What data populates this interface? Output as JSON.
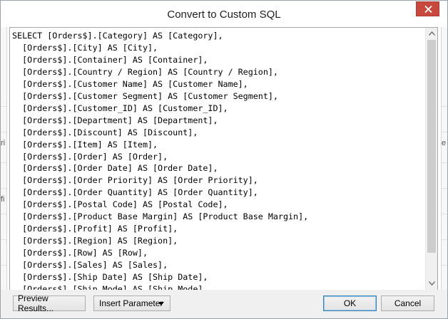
{
  "window": {
    "title": "Convert to Custom SQL"
  },
  "editor": {
    "lines": [
      "SELECT [Orders$].[Category] AS [Category],",
      "  [Orders$].[City] AS [City],",
      "  [Orders$].[Container] AS [Container],",
      "  [Orders$].[Country / Region] AS [Country / Region],",
      "  [Orders$].[Customer Name] AS [Customer Name],",
      "  [Orders$].[Customer Segment] AS [Customer Segment],",
      "  [Orders$].[Customer_ID] AS [Customer_ID],",
      "  [Orders$].[Department] AS [Department],",
      "  [Orders$].[Discount] AS [Discount],",
      "  [Orders$].[Item] AS [Item],",
      "  [Orders$].[Order] AS [Order],",
      "  [Orders$].[Order Date] AS [Order Date],",
      "  [Orders$].[Order Priority] AS [Order Priority],",
      "  [Orders$].[Order Quantity] AS [Order Quantity],",
      "  [Orders$].[Postal Code] AS [Postal Code],",
      "  [Orders$].[Product Base Margin] AS [Product Base Margin],",
      "  [Orders$].[Profit] AS [Profit],",
      "  [Orders$].[Region] AS [Region],",
      "  [Orders$].[Row] AS [Row],",
      "  [Orders$].[Sales] AS [Sales],",
      "  [Orders$].[Ship Date] AS [Ship Date],",
      "  [Orders$].[Ship Mode] AS [Ship Mode],"
    ]
  },
  "buttons": {
    "preview": "Preview Results...",
    "insert_parameter": "Insert Parameter",
    "ok": "OK",
    "cancel": "Cancel"
  },
  "background_edge": {
    "left_texts": [
      "ri",
      "fi"
    ],
    "right_texts": [
      "es"
    ]
  },
  "icons": {
    "close": "close-icon",
    "scroll_up": "chevron-up-icon",
    "scroll_down": "chevron-down-icon",
    "dropdown": "caret-down-icon"
  },
  "colors": {
    "close_button": "#c7483c",
    "ok_border": "#3c7fb1"
  }
}
